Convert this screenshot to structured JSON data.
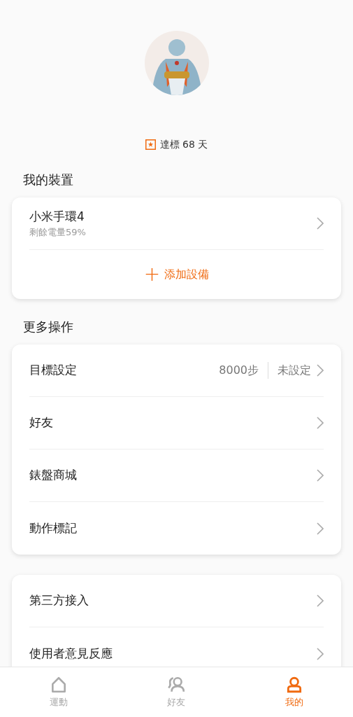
{
  "profile": {
    "badge": "達標 68 天"
  },
  "devices": {
    "title": "我的裝置",
    "items": [
      {
        "name": "小米手環4",
        "detail": "剩餘電量59%"
      }
    ],
    "add_button": {
      "icon": "+",
      "label": "添加設備"
    }
  },
  "more": {
    "title": "更多操作",
    "items": [
      {
        "label": "目標設定",
        "value": "8000步",
        "status": "未設定"
      },
      {
        "label": "好友"
      },
      {
        "label": "錶盤商城"
      },
      {
        "label": "動作標記"
      }
    ]
  },
  "other": {
    "items": [
      {
        "label": "第三方接入"
      },
      {
        "label": "使用者意見反應"
      }
    ]
  },
  "tabs": [
    {
      "label": "運動",
      "selected": false
    },
    {
      "label": "好友",
      "selected": false
    },
    {
      "label": "我的",
      "selected": true
    }
  ]
}
